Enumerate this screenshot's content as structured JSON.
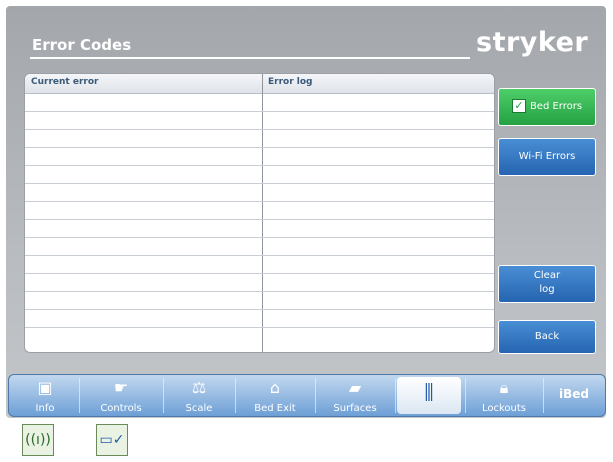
{
  "header": {
    "title": "Error Codes",
    "brand": "stryker"
  },
  "table": {
    "col_current": "Current error",
    "col_log": "Error log"
  },
  "side": {
    "bed_errors": "Bed Errors",
    "wifi_errors": "Wi-Fi Errors",
    "clear_log_line1": "Clear",
    "clear_log_line2": "log",
    "back": "Back"
  },
  "toolbar": {
    "items": [
      {
        "label": "Info",
        "icon": "info-icon"
      },
      {
        "label": "Controls",
        "icon": "controls-icon"
      },
      {
        "label": "Scale",
        "icon": "scale-icon"
      },
      {
        "label": "Bed Exit",
        "icon": "bed-exit-icon"
      },
      {
        "label": "Surfaces",
        "icon": "surfaces-icon"
      },
      {
        "label": "",
        "icon": "settings-sliders-icon"
      },
      {
        "label": "Lockouts",
        "icon": "lock-icon"
      },
      {
        "label": "iBed",
        "icon": "ibed-icon"
      }
    ]
  },
  "status": {
    "icons": [
      "wifi-status-icon",
      "bed-check-icon"
    ]
  },
  "colors": {
    "accent_blue": "#2563b0",
    "accent_green": "#23a042"
  }
}
